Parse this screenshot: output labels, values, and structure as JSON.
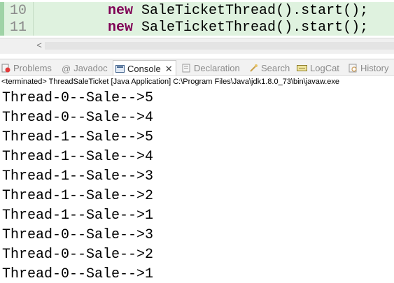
{
  "editor": {
    "lines": [
      {
        "number": "10",
        "keyword": "new",
        "code": "SaleTicketThread().start();"
      },
      {
        "number": "11",
        "keyword": "new",
        "code": "SaleTicketThread().start();"
      }
    ],
    "scroll_left_glyph": "<"
  },
  "tabs": [
    {
      "label": "Problems",
      "icon": "problems-icon"
    },
    {
      "label": "Javadoc",
      "icon": "at-icon",
      "glyph": "@"
    },
    {
      "label": "Console",
      "icon": "console-icon",
      "active": true,
      "close": "✕"
    },
    {
      "label": "Declaration",
      "icon": "declaration-icon"
    },
    {
      "label": "Search",
      "icon": "search-icon"
    },
    {
      "label": "LogCat",
      "icon": "logcat-icon"
    },
    {
      "label": "History",
      "icon": "history-icon"
    }
  ],
  "console": {
    "status": "<terminated> ThreadSaleTicket [Java Application] C:\\Program Files\\Java\\jdk1.8.0_73\\bin\\javaw.exe",
    "output": [
      "Thread-0--Sale-->5",
      "Thread-0--Sale-->4",
      "Thread-1--Sale-->5",
      "Thread-1--Sale-->4",
      "Thread-1--Sale-->3",
      "Thread-1--Sale-->2",
      "Thread-1--Sale-->1",
      "Thread-0--Sale-->3",
      "Thread-0--Sale-->2",
      "Thread-0--Sale-->1"
    ]
  },
  "colors": {
    "highlight": "#dff2df",
    "keyword": "#7f0055",
    "gutter": "#9fd3a6"
  }
}
